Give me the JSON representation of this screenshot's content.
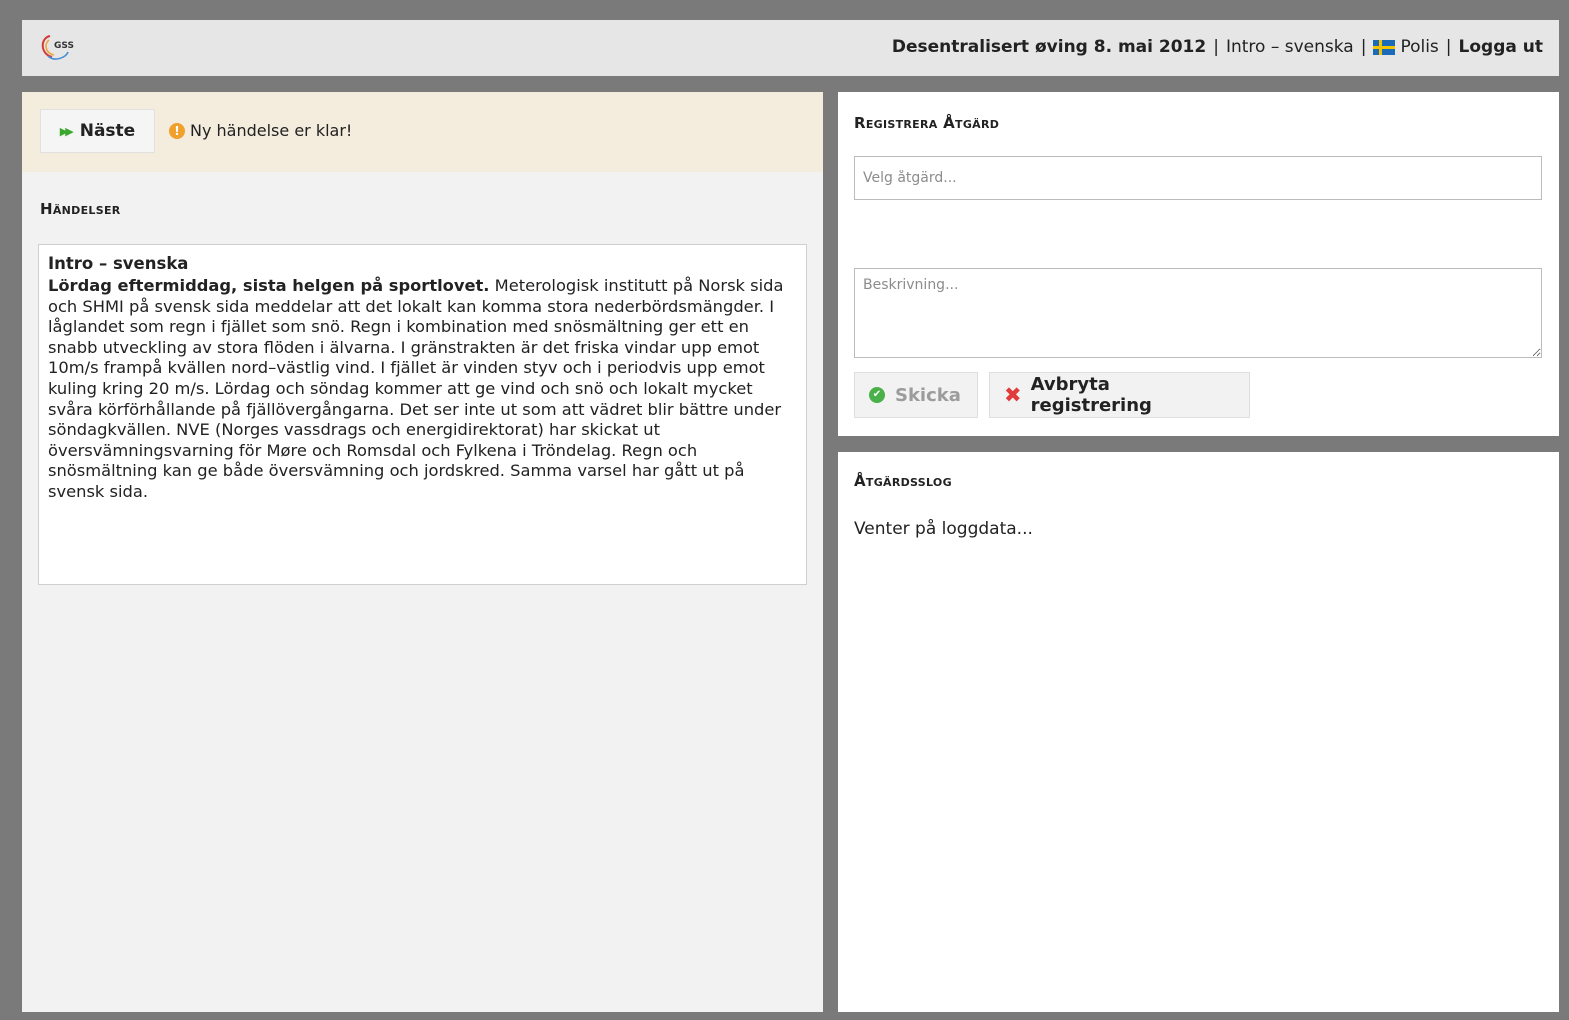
{
  "header": {
    "logo_text": "GSS",
    "exercise_title": "Desentralisert øving 8. mai 2012",
    "separator": "|",
    "scenario": "Intro – svenska",
    "role": "Polis",
    "logout_label": "Logga ut"
  },
  "toolbar": {
    "next_label": "Näste",
    "notice_text": "Ny händelse er klar!"
  },
  "events": {
    "section_title": "Händelser",
    "item_title": "Intro – svenska",
    "item_lead": "Lördag eftermiddag, sista helgen på sportlovet.",
    "item_body": " Meterologisk institutt på Norsk sida och SHMI på svensk sida meddelar att det lokalt kan komma stora nederbördsmängder. I låglandet som regn i fjället som snö. Regn i kombination med snösmältning ger ett en snabb utveckling av stora flöden i älvarna. I gränstrakten är det friska vindar upp emot 10m/s frampå kvällen nord–västlig vind. I fjället är vinden styv och i periodvis upp emot kuling kring 20 m/s. Lördag och söndag kommer att ge vind och snö och lokalt mycket svåra körförhållande på fjällövergångarna. Det ser inte ut som att vädret blir bättre under söndagkvällen. NVE (Norges vassdrags och energidirektorat) har skickat ut översvämningsvarning för Møre och Romsdal och Fylkena i Tröndelag. Regn och snösmältning kan ge både översvämning och jordskred. Samma varsel har gått ut på svensk sida."
  },
  "register": {
    "section_title": "Registrera Åtgärd",
    "action_placeholder": "Velg åtgärd...",
    "action_value": "",
    "description_placeholder": "Beskrivning...",
    "description_value": "",
    "send_label": "Skicka",
    "cancel_label": "Avbryta registrering"
  },
  "log": {
    "section_title": "Åtgärdsslog",
    "status_text": "Venter på loggdata..."
  },
  "colors": {
    "background": "#7a7a7a",
    "notice_bar": "#f4ecdd",
    "next_arrow": "#3aa82e",
    "warning": "#f0a02c",
    "send_icon": "#49b04a",
    "cancel_icon": "#e23b3b",
    "flag_blue": "#1b6bb8",
    "flag_yellow": "#f5c400"
  },
  "icons": {
    "logo": "gss-logo",
    "next": "double-play-arrow-icon",
    "notice": "exclamation-circle-icon",
    "flag": "swedish-flag-icon",
    "send": "check-circle-icon",
    "cancel": "x-mark-icon"
  }
}
